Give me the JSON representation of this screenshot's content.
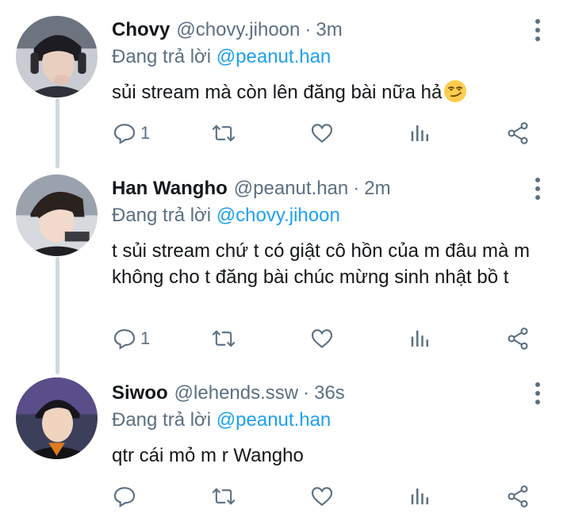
{
  "tweets": [
    {
      "display_name": "Chovy",
      "handle": "@chovy.jihoon",
      "dot": "·",
      "time": "3m",
      "reply_prefix": "Đang trả lời",
      "reply_to": "@peanut.han",
      "text": "sủi stream mà còn lên đăng bài nữa hả",
      "reply_count": "1"
    },
    {
      "display_name": "Han Wangho",
      "handle": "@peanut.han",
      "dot": "·",
      "time": "2m",
      "reply_prefix": "Đang trả lời",
      "reply_to": "@chovy.jihoon",
      "text": "t sủi stream chứ t có giật cô hồn của m đâu mà m không cho t đăng bài chúc mừng sinh nhật bồ t",
      "reply_count": "1"
    },
    {
      "display_name": "Siwoo",
      "handle": "@lehends.ssw",
      "dot": "·",
      "time": "36s",
      "reply_prefix": "Đang trả lời",
      "reply_to": "@peanut.han",
      "text": "qtr cái mỏ m r Wangho",
      "reply_count": ""
    }
  ],
  "icons": {
    "reply": "reply-icon",
    "retweet": "retweet-icon",
    "like": "heart-icon",
    "analytics": "analytics-icon",
    "share": "share-icon",
    "more": "more-vertical-icon",
    "emoji": "smirking-face-emoji"
  },
  "colors": {
    "link": "#1da1f2",
    "secondary": "#5b7083",
    "thread_line": "#cfd9de"
  }
}
